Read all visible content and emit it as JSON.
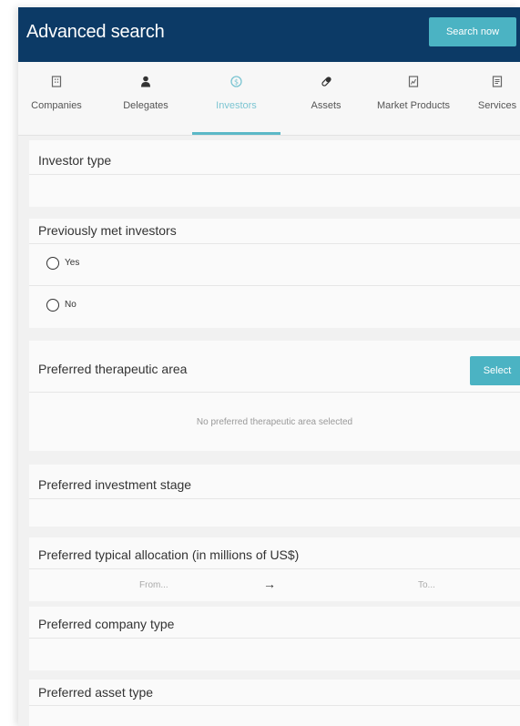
{
  "header": {
    "title": "Advanced search",
    "search_button": "Search now"
  },
  "tabs": [
    {
      "label": "Companies",
      "icon": "building-icon",
      "active": false
    },
    {
      "label": "Delegates",
      "icon": "person-icon",
      "active": false
    },
    {
      "label": "Investors",
      "icon": "coin-icon",
      "active": true
    },
    {
      "label": "Assets",
      "icon": "pill-icon",
      "active": false
    },
    {
      "label": "Market Products",
      "icon": "product-box-icon",
      "active": false
    },
    {
      "label": "Services",
      "icon": "document-icon",
      "active": false
    }
  ],
  "sections": {
    "investor_type": {
      "title": "Investor type"
    },
    "previously_met": {
      "title": "Previously met investors",
      "options": [
        "Yes",
        "No"
      ]
    },
    "therapeutic_area": {
      "title": "Preferred therapeutic area",
      "select_button": "Select",
      "empty_text": "No preferred therapeutic area selected"
    },
    "investment_stage": {
      "title": "Preferred investment stage"
    },
    "typical_allocation": {
      "title": "Preferred typical allocation (in millions of US$)",
      "from_placeholder": "From...",
      "arrow": "→",
      "to_placeholder": "To..."
    },
    "company_type": {
      "title": "Preferred company type"
    },
    "asset_type": {
      "title": "Preferred asset type"
    }
  },
  "colors": {
    "header_bg": "#0c3a66",
    "accent": "#4bb3c3",
    "active_tab": "#7cc5d2"
  }
}
